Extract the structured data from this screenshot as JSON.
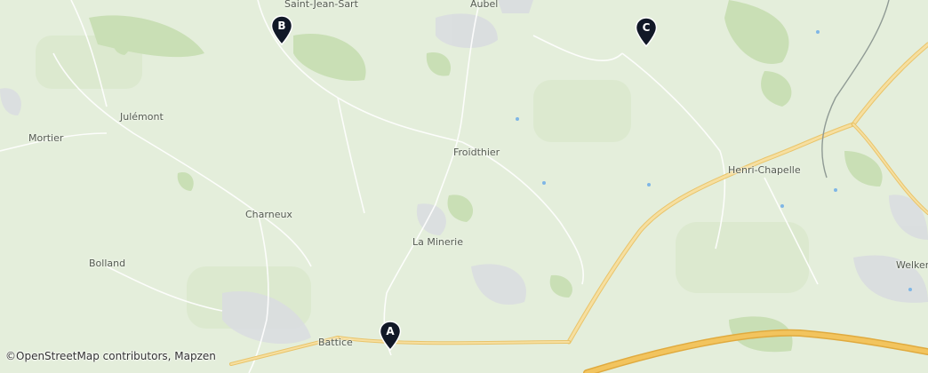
{
  "map": {
    "places": {
      "saint_jean_sart": "Saint-Jean-Sart",
      "aubel": "Aubel",
      "julemont": "Julémont",
      "mortier": "Mortier",
      "froidthier": "Froidthier",
      "henri_chapelle": "Henri-Chapelle",
      "charneux": "Charneux",
      "la_minerie": "La Minerie",
      "bolland": "Bolland",
      "welkenraedt": "Welkenr",
      "battice": "Battice"
    },
    "markers": {
      "a": "A",
      "b": "B",
      "c": "C"
    },
    "colors": {
      "background": "#e4eedb",
      "forest": "#c9dfb5",
      "road_major": "#f2d38a",
      "road_minor": "#ffffff",
      "urban": "#d9d9dd",
      "marker": "#111827"
    }
  },
  "attribution": {
    "icon": "©",
    "openstreetmap": "OpenStreetMap contributors",
    "separator": ", ",
    "mapzen": "Mapzen"
  }
}
